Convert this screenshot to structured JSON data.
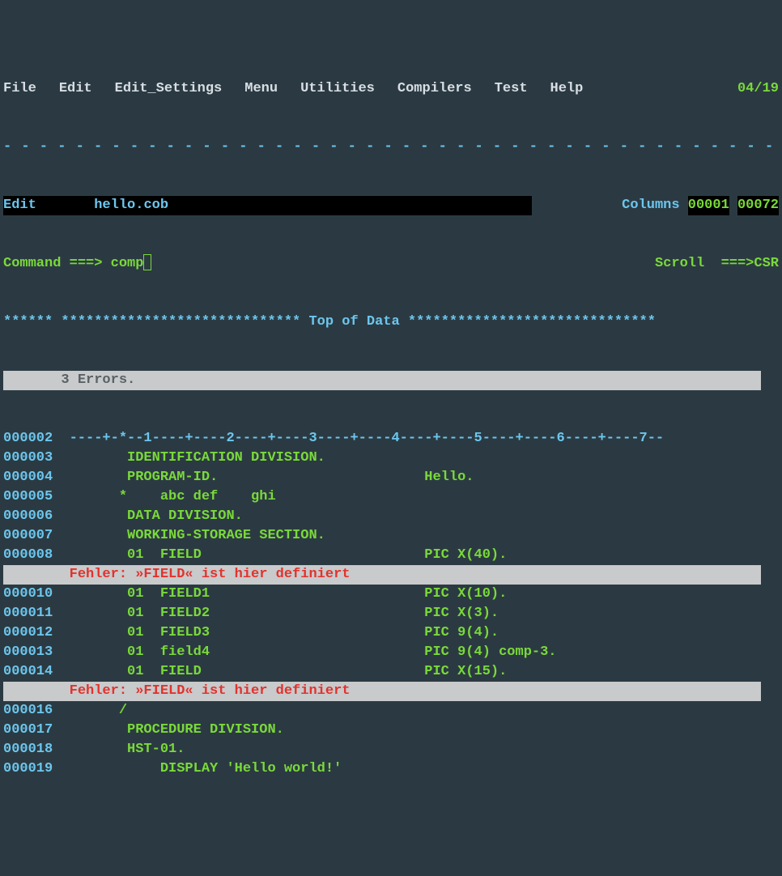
{
  "menu": {
    "items": [
      "File",
      "Edit",
      "Edit_Settings",
      "Menu",
      "Utilities",
      "Compilers",
      "Test",
      "Help"
    ],
    "page": "04/19"
  },
  "header": {
    "mode": "Edit",
    "filename": "hello.cob",
    "columns_label": "Columns",
    "col_start": "00001",
    "col_end": "00072",
    "command_label": "Command ===>",
    "command_value": "comp",
    "scroll_label": "Scroll  ===>",
    "scroll_value": "CSR"
  },
  "top_of_data": "****** ***************************** Top of Data ******************************",
  "error_summary": "       3 Errors.",
  "ruler": "----+-*--1----+----2----+----3----+----4----+----5----+----6----+----7--",
  "lines": [
    {
      "no": "000002",
      "type": "ruler"
    },
    {
      "no": "000003",
      "text": "       IDENTIFICATION DIVISION."
    },
    {
      "no": "000004",
      "text": "       PROGRAM-ID.                         Hello."
    },
    {
      "no": "000005",
      "text": "      *    abc def    ghi"
    },
    {
      "no": "000006",
      "text": "       DATA DIVISION."
    },
    {
      "no": "000007",
      "text": "       WORKING-STORAGE SECTION."
    },
    {
      "no": "000008",
      "text": "       01  FIELD                           PIC X(40)."
    },
    {
      "type": "error",
      "text": "        Fehler: »FIELD« ist hier definiert"
    },
    {
      "no": "000010",
      "text": "       01  FIELD1                          PIC X(10)."
    },
    {
      "no": "000011",
      "text": "       01  FIELD2                          PIC X(3)."
    },
    {
      "no": "000012",
      "text": "       01  FIELD3                          PIC 9(4)."
    },
    {
      "no": "000013",
      "text": "       01  field4                          PIC 9(4) comp-3."
    },
    {
      "no": "000014",
      "text": "       01  FIELD                           PIC X(15)."
    },
    {
      "type": "error",
      "text": "        Fehler: »FIELD« ist hier definiert"
    },
    {
      "no": "000016",
      "text": "      /"
    },
    {
      "no": "000017",
      "text": "       PROCEDURE DIVISION."
    },
    {
      "no": "000018",
      "text": "       HST-01."
    },
    {
      "no": "000019",
      "text": "           DISPLAY 'Hello world!'"
    }
  ]
}
